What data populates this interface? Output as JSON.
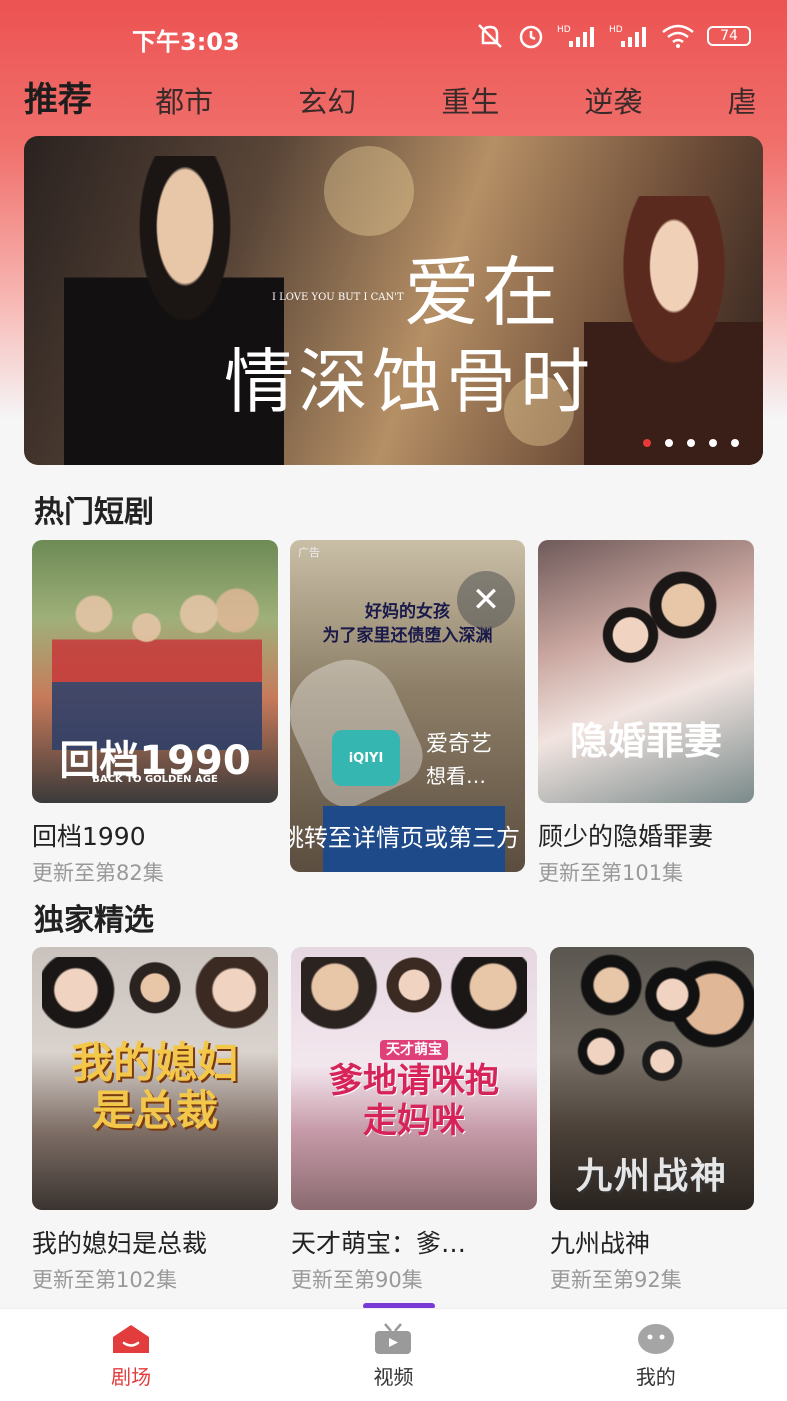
{
  "status_bar": {
    "time": "下午3:03",
    "battery": "74"
  },
  "tabs": [
    "推荐",
    "都市",
    "玄幻",
    "重生",
    "逆袭",
    "虐"
  ],
  "banner": {
    "title_top": "爱在",
    "title_bottom": "情深蚀骨时",
    "subtitle_en": "I LOVE YOU BUT I CAN'T",
    "dot_count": 5,
    "active_dot": 0
  },
  "sections": {
    "hot": {
      "title": "热门短剧",
      "items": [
        {
          "title": "回档1990",
          "subtitle": "更新至第82集",
          "poster_text": "回档1990",
          "poster_sub": "BACK TO GOLDEN AGE"
        },
        {
          "title": "顾少的隐婚罪妻",
          "subtitle": "更新至第101集",
          "poster_text": "隐婚罪妻"
        }
      ]
    },
    "exclusive": {
      "title": "独家精选",
      "items": [
        {
          "title": "我的媳妇是总裁",
          "subtitle": "更新至第102集",
          "poster_text": "我的媳妇是总裁"
        },
        {
          "title": "天才萌宝：爹…",
          "subtitle": "更新至第90集",
          "poster_text": "爹地请咪抱走妈咪",
          "poster_tag": "天才萌宝"
        },
        {
          "title": "九州战神",
          "subtitle": "更新至第92集",
          "poster_text": "九州战神"
        }
      ]
    }
  },
  "ad": {
    "label": "广告",
    "headline_line1": "好妈的女孩",
    "headline_line2": "为了家里还债堕入深渊",
    "brand_logo": "iQIYI",
    "brand": "爱奇艺",
    "want": "想看…",
    "cta": "跳转至详情页或第三方",
    "close_icon": "close-icon"
  },
  "bottom_nav": [
    {
      "label": "剧场",
      "icon": "theater-icon",
      "active": true
    },
    {
      "label": "视频",
      "icon": "tv-icon",
      "active": false
    },
    {
      "label": "我的",
      "icon": "profile-icon",
      "active": false
    }
  ],
  "colors": {
    "accent": "#e23c3c",
    "header_top": "#ec5352"
  }
}
